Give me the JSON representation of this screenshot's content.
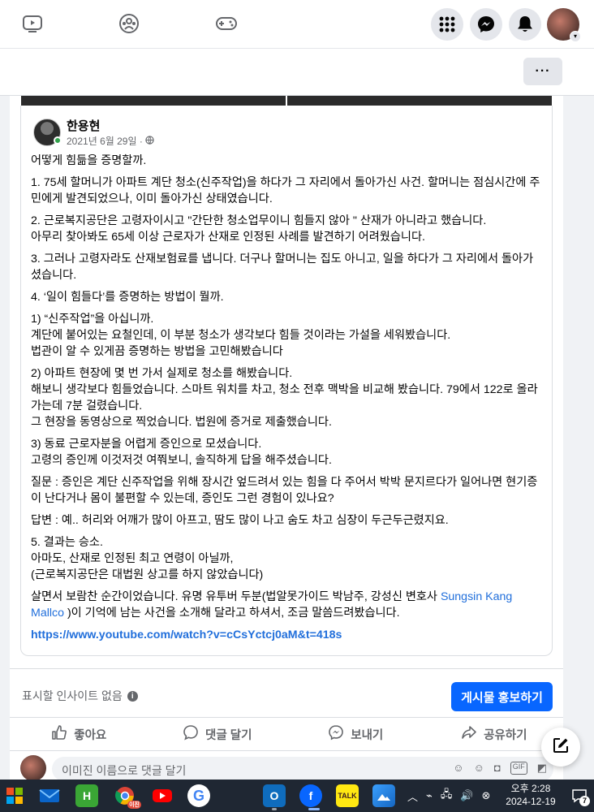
{
  "topnav": {
    "icons": [
      "video-icon",
      "groups-icon",
      "gaming-icon"
    ],
    "right_buttons": [
      "menu-grid-icon",
      "messenger-icon",
      "bell-icon"
    ]
  },
  "subbar": {
    "more_label": "···"
  },
  "post": {
    "author": "한용현",
    "date": "2021년 6월 29일 ·",
    "paragraphs": [
      "어떻게 힘듦을 증명할까.",
      "1. 75세 할머니가 아파트 계단 청소(신주작업)을 하다가 그 자리에서 돌아가신 사건. 할머니는 점심시간에 주민에게 발견되었으나, 이미 돌아가신 상태였습니다.",
      "2. 근로복지공단은 고령자이시고 \"간단한 청소업무이니 힘들지 않아 \" 산재가 아니라고 했습니다.\n아무리 찾아봐도 65세 이상 근로자가 산재로 인정된 사례를 발견하기 어려웠습니다.",
      "3. 그러나 고령자라도 산재보험료를 냅니다. 더구나 할머니는 집도 아니고, 일을 하다가 그 자리에서 돌아가셨습니다.",
      "4. ‘일이 힘들다’를 증명하는 방법이 뭘까.",
      "1) “신주작업”을 아십니까.\n계단에 붙어있는 요철인데, 이 부분 청소가 생각보다 힘들 것이라는 가설을 세워봤습니다.\n법관이 알 수 있게끔 증명하는 방법을 고민해봤습니다",
      "2) 아파트 현장에 몇 번 가서 실제로 청소를 해봤습니다.\n해보니 생각보다 힘들었습니다. 스마트 워치를 차고, 청소 전후 맥박을 비교해 봤습니다. 79에서 122로 올라가는데 7분 걸렸습니다.\n그 현장을 동영상으로 찍었습니다. 법원에 증거로 제출했습니다.",
      "3) 동료 근로자분을 어렵게 증인으로 모셨습니다.\n고령의 증인께 이것저것 여쭤보니, 솔직하게 답을 해주셨습니다.",
      "질문 : 증인은 계단 신주작업을 위해 장시간 엎드려서 있는 힘을 다 주어서 박박 문지르다가 일어나면 현기증이 난다거나 몸이 불편할 수 있는데, 증인도 그런 경험이 있나요?",
      "답변 : 예.. 허리와 어깨가 많이 아프고, 땀도 많이 나고 숨도 차고 심장이 두근두근렸지요.",
      "5. 결과는 승소.\n아마도, 산재로 인정된 최고 연령이 아닐까,\n(근로복지공단은 대법원 상고를 하지 않았습니다)"
    ],
    "last_paragraph_prefix": "살면서 보람찬 순간이었습니다. 유명 유투버 두분(법알못가이드 박남주, 강성신 변호사 ",
    "mention": "Sungsin Kang Mallco",
    "last_paragraph_suffix": " )이 기억에 남는 사건을 소개해 달라고 하셔서, 조금 말씀드려봤습니다.",
    "url": "https://www.youtube.com/watch?v=cCsYctcj0aM&t=418s"
  },
  "insights": {
    "label": "표시할 인사이트 없음",
    "promote_button": "게시물 홍보하기"
  },
  "actions": {
    "like": "좋아요",
    "comment": "댓글 달기",
    "send": "보내기",
    "share": "공유하기"
  },
  "comment_box": {
    "placeholder": "이미진 이름으로 댓글 달기"
  },
  "taskbar": {
    "clock_time": "오후 2:28",
    "clock_date": "2024-12-19",
    "notification_count": "7",
    "badge_label": "이진"
  },
  "colors": {
    "accent": "#0866ff",
    "link": "#216fdb",
    "online": "#31a24c",
    "taskbar": "#1f2733"
  }
}
